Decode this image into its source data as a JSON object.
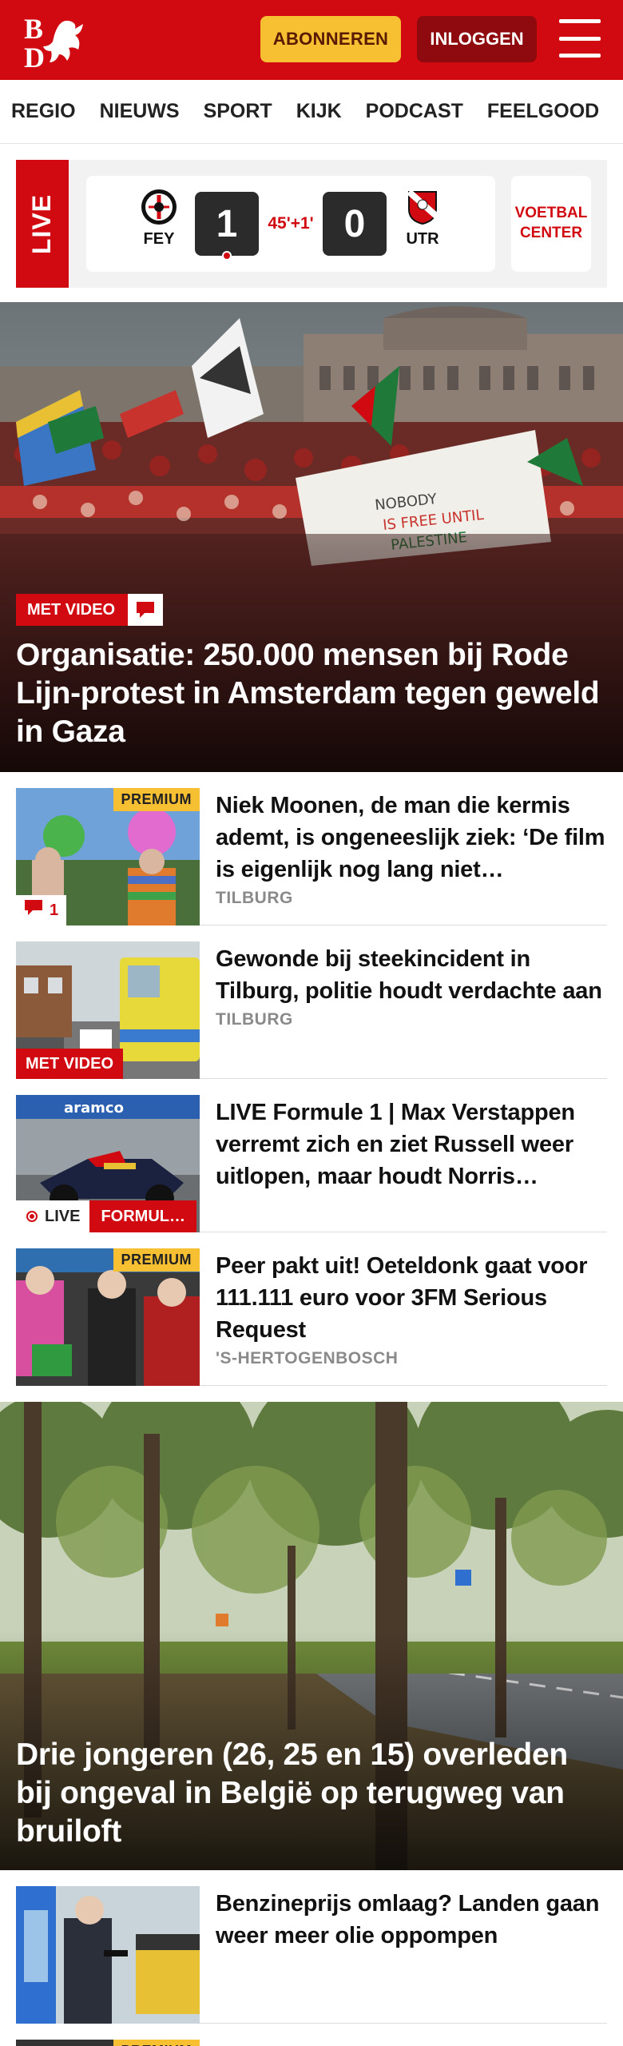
{
  "header": {
    "logo_text": "BD",
    "subscribe_label": "ABONNEREN",
    "login_label": "INLOGGEN",
    "brand_color": "#d10a11"
  },
  "nav": {
    "items": [
      {
        "label": "REGIO"
      },
      {
        "label": "NIEUWS"
      },
      {
        "label": "SPORT"
      },
      {
        "label": "KIJK"
      },
      {
        "label": "PODCAST"
      },
      {
        "label": "FEELGOOD"
      }
    ]
  },
  "live_score": {
    "tag": "LIVE",
    "home": {
      "abbr": "FEY",
      "score": "1"
    },
    "away": {
      "abbr": "UTR",
      "score": "0"
    },
    "minute": "45'+1'",
    "center_label_line1": "VOETBAL",
    "center_label_line2": "CENTER"
  },
  "hero": {
    "badge": "MET VIDEO",
    "title": "Organisatie: 250.000 mensen bij Rode Lijn-protest in Amsterdam tegen geweld in Gaza"
  },
  "articles": [
    {
      "title": "Niek Moonen, de man die kermis ademt, is ongeneeslijk ziek: ‘De film is eigenlijk nog lang niet…",
      "category": "TILBURG",
      "premium": "PREMIUM",
      "comments": "1"
    },
    {
      "title": "Gewonde bij steekincident in Tilburg, politie houdt verdachte aan",
      "category": "TILBURG",
      "badge": "MET VIDEO"
    },
    {
      "title": "LIVE Formule 1 | Max Verstappen verremt zich en ziet Russell weer uitlopen, maar houdt Norris…",
      "live_label": "LIVE",
      "badge": "FORMUL…"
    },
    {
      "title": "Peer pakt uit! Oeteldonk gaat voor 111.111 euro voor 3FM Serious Request",
      "category": "'S-HERTOGENBOSCH",
      "premium": "PREMIUM"
    }
  ],
  "hero2": {
    "title": "Drie jongeren (26, 25 en 15) overleden bij ongeval in België op terugweg van bruiloft"
  },
  "articles2": [
    {
      "title": "Benzineprijs omlaag? Landen gaan weer meer olie oppompen"
    },
    {
      "premium": "PREMIUM"
    }
  ]
}
